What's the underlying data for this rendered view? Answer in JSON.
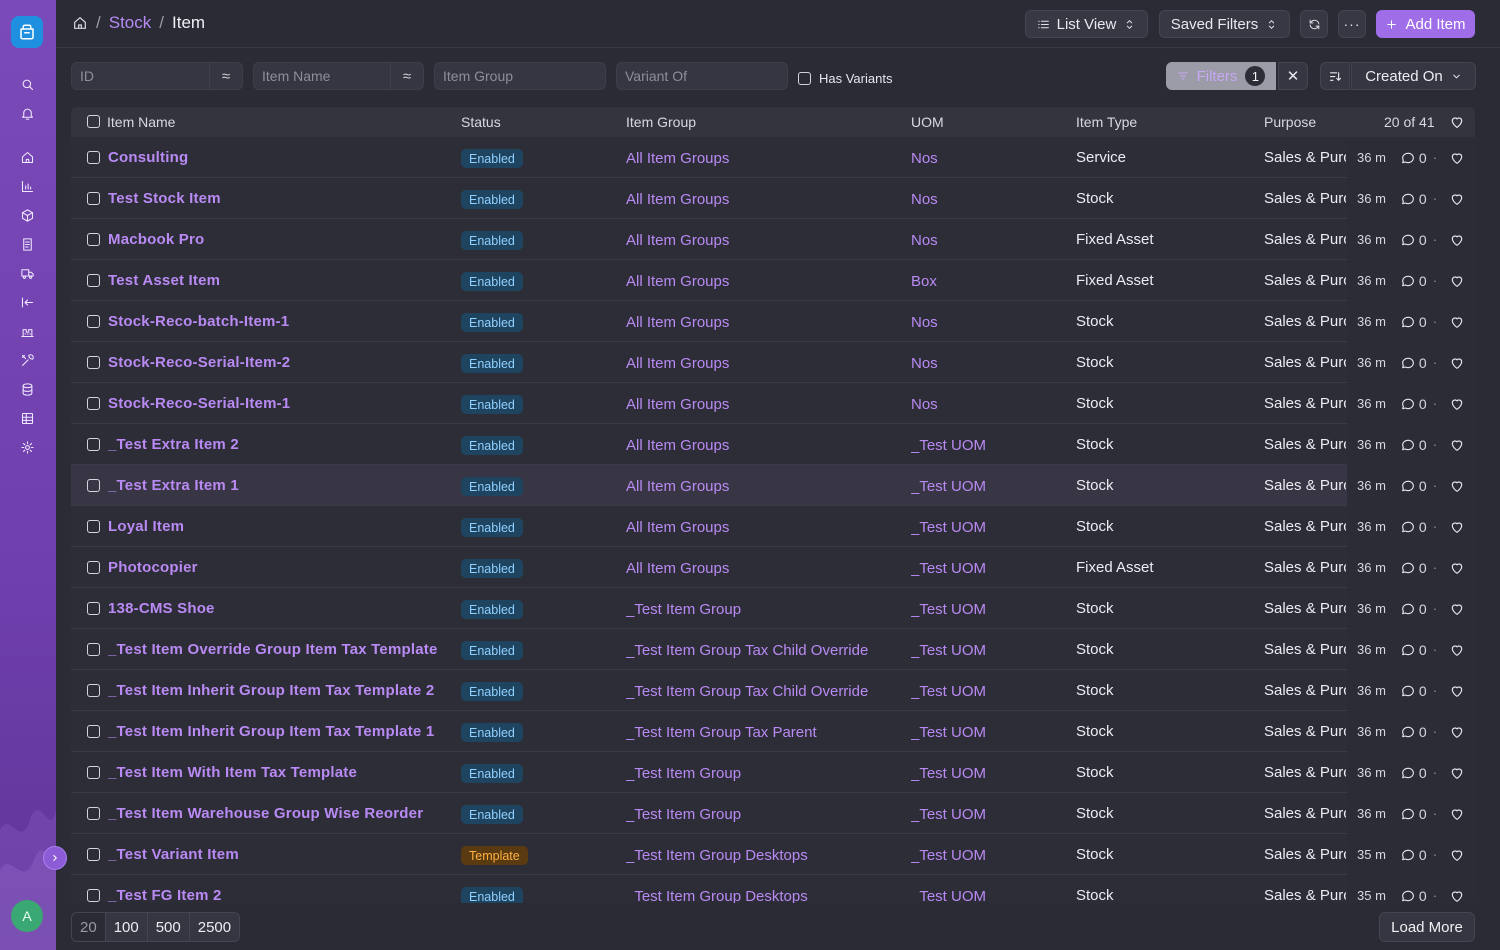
{
  "breadcrumb": {
    "module": "Stock",
    "doctype": "Item"
  },
  "toolbar": {
    "view_label": "List View",
    "saved_filters_label": "Saved Filters",
    "add_label": "Add Item"
  },
  "filters": {
    "id_placeholder": "ID",
    "item_name_placeholder": "Item Name",
    "item_group_placeholder": "Item Group",
    "variant_of_placeholder": "Variant Of",
    "has_variants_label": "Has Variants",
    "filters_label": "Filters",
    "filters_count": "1",
    "sort_label": "Created On"
  },
  "columns": {
    "item_name": "Item Name",
    "status": "Status",
    "item_group": "Item Group",
    "uom": "UOM",
    "item_type": "Item Type",
    "purpose": "Purpose",
    "count": "20 of 41"
  },
  "rows": [
    {
      "name": "Consulting",
      "status": "Enabled",
      "group": "All Item Groups",
      "uom": "Nos",
      "type": "Service",
      "purpose": "Sales & Purchase",
      "time": "36 m",
      "comments": "0"
    },
    {
      "name": "Test Stock Item",
      "status": "Enabled",
      "group": "All Item Groups",
      "uom": "Nos",
      "type": "Stock",
      "purpose": "Sales & Purchase",
      "time": "36 m",
      "comments": "0"
    },
    {
      "name": "Macbook Pro",
      "status": "Enabled",
      "group": "All Item Groups",
      "uom": "Nos",
      "type": "Fixed Asset",
      "purpose": "Sales & Purchase",
      "time": "36 m",
      "comments": "0"
    },
    {
      "name": "Test Asset Item",
      "status": "Enabled",
      "group": "All Item Groups",
      "uom": "Box",
      "type": "Fixed Asset",
      "purpose": "Sales & Purchase",
      "time": "36 m",
      "comments": "0"
    },
    {
      "name": "Stock-Reco-batch-Item-1",
      "status": "Enabled",
      "group": "All Item Groups",
      "uom": "Nos",
      "type": "Stock",
      "purpose": "Sales & Purchase",
      "time": "36 m",
      "comments": "0"
    },
    {
      "name": "Stock-Reco-Serial-Item-2",
      "status": "Enabled",
      "group": "All Item Groups",
      "uom": "Nos",
      "type": "Stock",
      "purpose": "Sales & Purchase",
      "time": "36 m",
      "comments": "0"
    },
    {
      "name": "Stock-Reco-Serial-Item-1",
      "status": "Enabled",
      "group": "All Item Groups",
      "uom": "Nos",
      "type": "Stock",
      "purpose": "Sales & Purchase",
      "time": "36 m",
      "comments": "0"
    },
    {
      "name": "_Test Extra Item 2",
      "status": "Enabled",
      "group": "All Item Groups",
      "uom": "_Test UOM",
      "type": "Stock",
      "purpose": "Sales & Purchase",
      "time": "36 m",
      "comments": "0"
    },
    {
      "name": "_Test Extra Item 1",
      "status": "Enabled",
      "group": "All Item Groups",
      "uom": "_Test UOM",
      "type": "Stock",
      "purpose": "Sales & Purchase",
      "time": "36 m",
      "comments": "0"
    },
    {
      "name": "Loyal Item",
      "status": "Enabled",
      "group": "All Item Groups",
      "uom": "_Test UOM",
      "type": "Stock",
      "purpose": "Sales & Purchase",
      "time": "36 m",
      "comments": "0"
    },
    {
      "name": "Photocopier",
      "status": "Enabled",
      "group": "All Item Groups",
      "uom": "_Test UOM",
      "type": "Fixed Asset",
      "purpose": "Sales & Purchase",
      "time": "36 m",
      "comments": "0"
    },
    {
      "name": "138-CMS Shoe",
      "status": "Enabled",
      "group": "_Test Item Group",
      "uom": "_Test UOM",
      "type": "Stock",
      "purpose": "Sales & Purchase",
      "time": "36 m",
      "comments": "0"
    },
    {
      "name": "_Test Item Override Group Item Tax Template",
      "status": "Enabled",
      "group": "_Test Item Group Tax Child Override",
      "uom": "_Test UOM",
      "type": "Stock",
      "purpose": "Sales & Purchase",
      "time": "36 m",
      "comments": "0"
    },
    {
      "name": "_Test Item Inherit Group Item Tax Template 2",
      "status": "Enabled",
      "group": "_Test Item Group Tax Child Override",
      "uom": "_Test UOM",
      "type": "Stock",
      "purpose": "Sales & Purchase",
      "time": "36 m",
      "comments": "0"
    },
    {
      "name": "_Test Item Inherit Group Item Tax Template 1",
      "status": "Enabled",
      "group": "_Test Item Group Tax Parent",
      "uom": "_Test UOM",
      "type": "Stock",
      "purpose": "Sales & Purchase",
      "time": "36 m",
      "comments": "0"
    },
    {
      "name": "_Test Item With Item Tax Template",
      "status": "Enabled",
      "group": "_Test Item Group",
      "uom": "_Test UOM",
      "type": "Stock",
      "purpose": "Sales & Purchase",
      "time": "36 m",
      "comments": "0"
    },
    {
      "name": "_Test Item Warehouse Group Wise Reorder",
      "status": "Enabled",
      "group": "_Test Item Group",
      "uom": "_Test UOM",
      "type": "Stock",
      "purpose": "Sales & Purchase",
      "time": "36 m",
      "comments": "0"
    },
    {
      "name": "_Test Variant Item",
      "status": "Template",
      "group": "_Test Item Group Desktops",
      "uom": "_Test UOM",
      "type": "Stock",
      "purpose": "Sales & Purchase",
      "time": "35 m",
      "comments": "0"
    },
    {
      "name": "_Test FG Item 2",
      "status": "Enabled",
      "group": "_Test Item Group Desktops",
      "uom": "_Test UOM",
      "type": "Stock",
      "purpose": "Sales & Purchase",
      "time": "35 m",
      "comments": "0"
    }
  ],
  "footer": {
    "page_sizes": [
      "20",
      "100",
      "500",
      "2500"
    ],
    "load_more_label": "Load More"
  },
  "user": {
    "avatar_initial": "A"
  },
  "colors": {
    "accent": "#a06de9",
    "sidebar": "#7a4ab8",
    "enabled_badge": "#1f4460",
    "template_badge": "#5a3a10"
  }
}
